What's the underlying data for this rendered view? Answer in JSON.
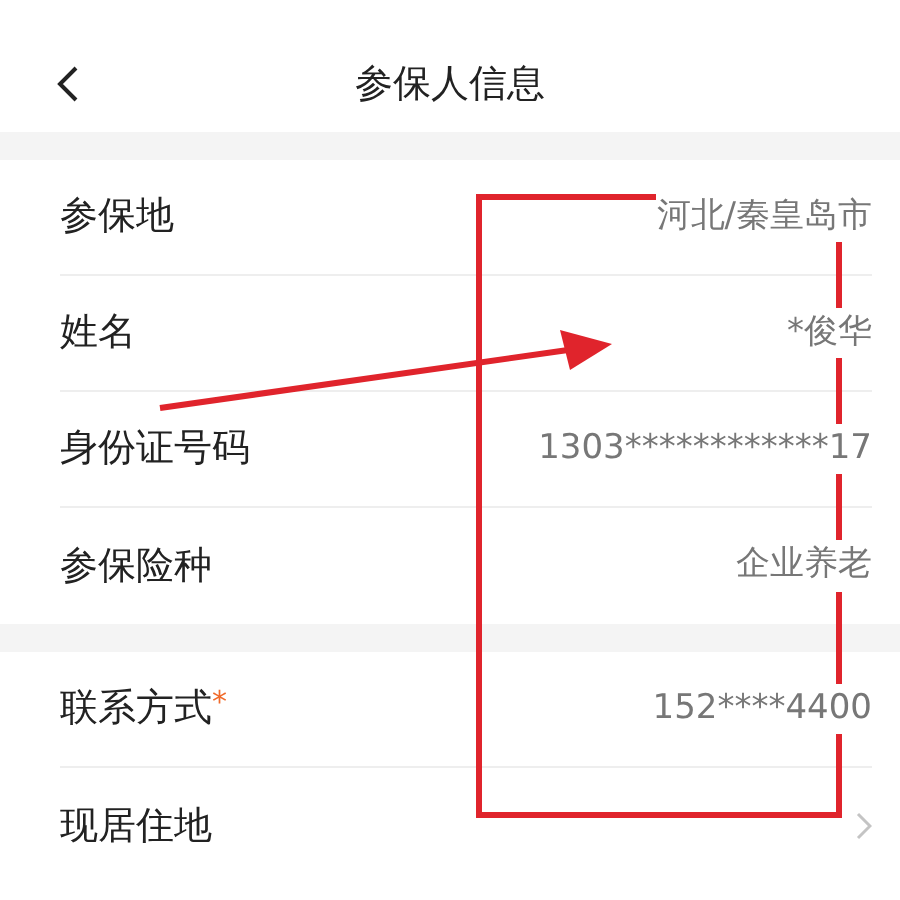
{
  "header": {
    "title": "参保人信息"
  },
  "sections": [
    {
      "rows": [
        {
          "label": "参保地",
          "value": "河北/秦皇岛市",
          "required": false,
          "kind": "text"
        },
        {
          "label": "姓名",
          "value": "*俊华",
          "required": false,
          "kind": "text"
        },
        {
          "label": "身份证号码",
          "value": "1303************17",
          "required": false,
          "kind": "text"
        },
        {
          "label": "参保险种",
          "value": "企业养老",
          "required": false,
          "kind": "text"
        }
      ]
    },
    {
      "rows": [
        {
          "label": "联系方式",
          "value": "152****4400",
          "required": true,
          "required_mark": "*",
          "kind": "text"
        },
        {
          "label": "现居住地",
          "required": false,
          "kind": "link"
        }
      ]
    }
  ]
}
